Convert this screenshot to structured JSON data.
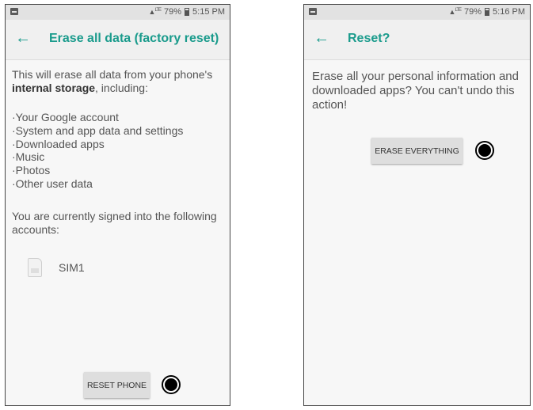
{
  "left_screen": {
    "status": {
      "network": "LTE",
      "battery": "79%",
      "time": "5:15 PM"
    },
    "title": "Erase all data (factory reset)",
    "intro_prefix": "This will erase all data from your phone's",
    "intro_bold": "internal storage",
    "intro_suffix": ", including:",
    "items": [
      "·Your Google account",
      "·System and app data and settings",
      "·Downloaded apps",
      "·Music",
      "·Photos",
      "·Other user data"
    ],
    "signed_in_text": "You are currently signed into the following accounts:",
    "account_label": "SIM1",
    "button_label": "RESET PHONE"
  },
  "right_screen": {
    "status": {
      "network": "LTE",
      "battery": "79%",
      "time": "5:16 PM"
    },
    "title": "Reset?",
    "message": "Erase all your personal information and downloaded apps? You can't undo this action!",
    "button_label": "ERASE EVERYTHING"
  },
  "colors": {
    "accent": "#1a9b8c",
    "app_bar": "#f0f0f0",
    "status_bar": "#e2e2e2",
    "button": "#dedede"
  }
}
